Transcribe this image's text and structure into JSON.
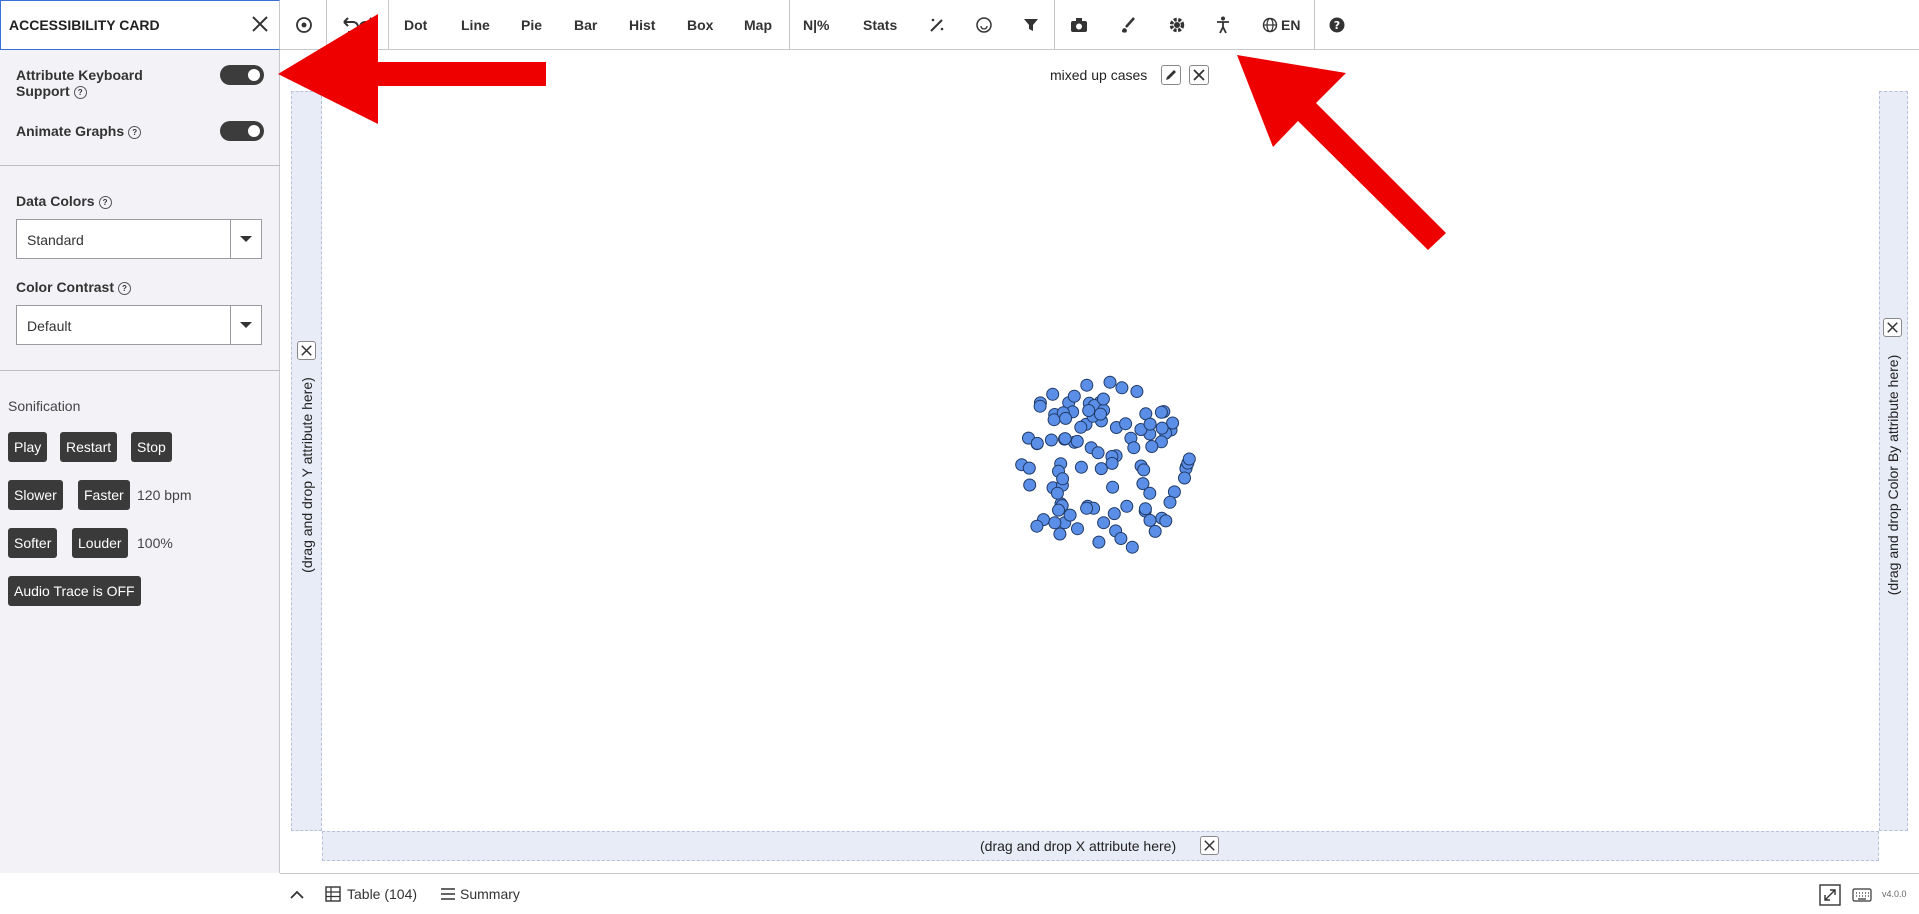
{
  "card": {
    "title": "ACCESSIBILITY CARD"
  },
  "toolbar": {
    "plot_types": [
      "Dot",
      "Line",
      "Pie",
      "Bar",
      "Hist",
      "Box",
      "Map"
    ],
    "count_label": "N|%",
    "stats_label": "Stats",
    "language": "EN"
  },
  "sidebar": {
    "keyboard_label_line1": "Attribute Keyboard",
    "keyboard_label_line2": "Support",
    "animate_label": "Animate Graphs",
    "data_colors_label": "Data Colors",
    "data_colors_value": "Standard",
    "contrast_label": "Color Contrast",
    "contrast_value": "Default",
    "sonification_label": "Sonification",
    "play": "Play",
    "restart": "Restart",
    "stop": "Stop",
    "slower": "Slower",
    "faster": "Faster",
    "tempo": "120 bpm",
    "softer": "Softer",
    "louder": "Louder",
    "volume": "100%",
    "audio_trace": "Audio Trace is OFF"
  },
  "graph": {
    "title": "mixed up cases",
    "y_drop": "(drag and drop Y attribute here)",
    "x_drop": "(drag and drop X attribute here)",
    "color_drop": "(drag and drop Color By attribute here)",
    "point_color": "#5b8ee6"
  },
  "bottom": {
    "table": "Table (104)",
    "summary": "Summary",
    "version": "v4.0.0"
  },
  "colors": {
    "accent": "#3b6fd8",
    "annotation": "#ee0000"
  }
}
